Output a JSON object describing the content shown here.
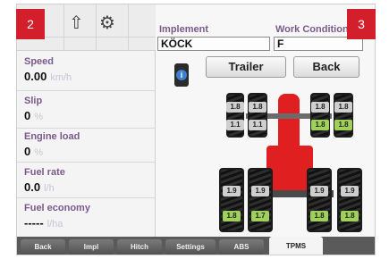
{
  "overlay": {
    "left_number": "2",
    "right_number": "3",
    "badge_color": "#d21f2b"
  },
  "icons": [
    "hitch-icon",
    "arrow-up-icon",
    "tractor-settings-icon"
  ],
  "metrics": [
    {
      "label": "Speed",
      "value": "0.00",
      "unit": "km/h"
    },
    {
      "label": "Slip",
      "value": "0",
      "unit": "%"
    },
    {
      "label": "Engine load",
      "value": "0",
      "unit": "%"
    },
    {
      "label": "Fuel rate",
      "value": "0.0",
      "unit": "l/h"
    },
    {
      "label": "Fuel economy",
      "value": "-----",
      "unit": "l/ha"
    }
  ],
  "implement": {
    "label": "Implement",
    "value": "KÖCK"
  },
  "work_condition": {
    "label": "Work Condition",
    "value": "F"
  },
  "buttons": {
    "trailer": "Trailer",
    "back": "Back"
  },
  "tire_pressures": {
    "front_left_outer": {
      "set": "1.8",
      "actual": "1.1"
    },
    "front_left_inner": {
      "set": "1.8",
      "actual": "1.1"
    },
    "front_right_inner": {
      "set": "1.8",
      "actual": "1.8"
    },
    "front_right_outer": {
      "set": "1.8",
      "actual": "1.8"
    },
    "rear_left_outer": {
      "set": "1.9",
      "actual": "1.8"
    },
    "rear_left_inner": {
      "set": "1.9",
      "actual": "1.7"
    },
    "rear_right_inner": {
      "set": "1.9",
      "actual": "1.8"
    },
    "rear_right_outer": {
      "set": "1.9",
      "actual": "1.8"
    }
  },
  "tabs": [
    "Back",
    "Impl",
    "Hitch",
    "Settings",
    "ABS",
    "TPMS"
  ],
  "active_tab": "TPMS",
  "colors": {
    "tractor": "#e02020",
    "label": "#7a5a8a",
    "ok_tag": "#9fd05a"
  }
}
